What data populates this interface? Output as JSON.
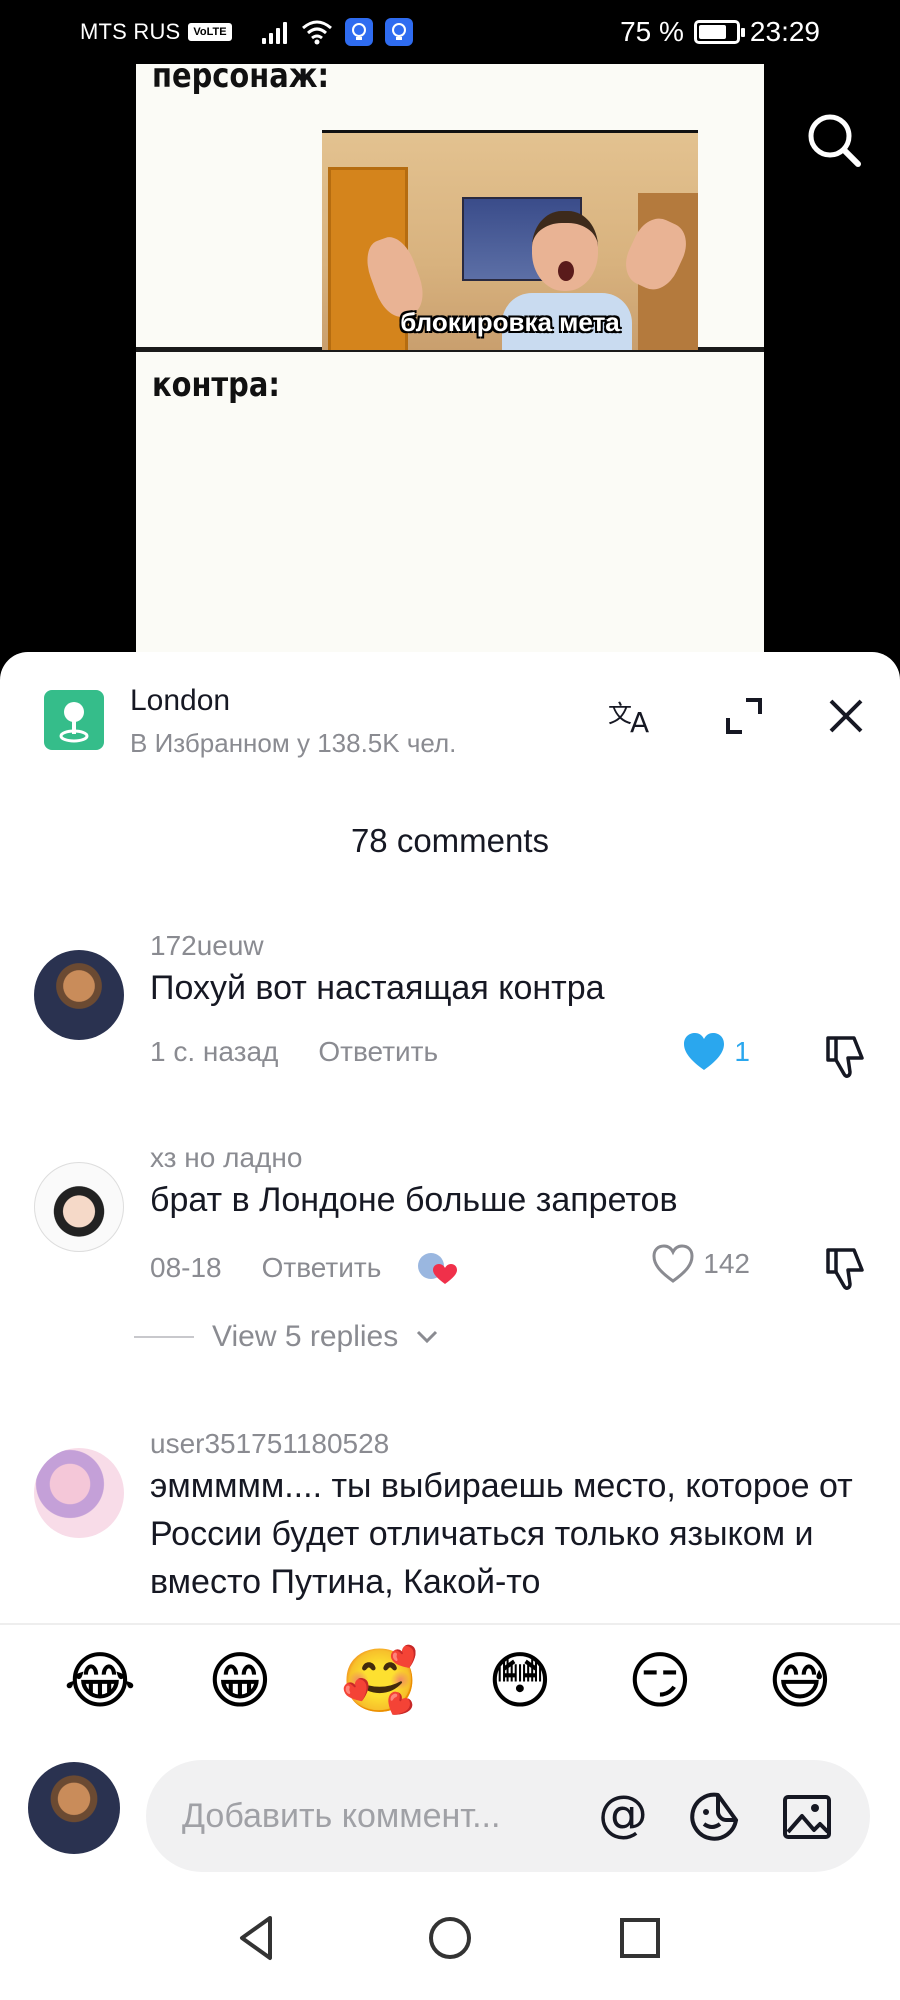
{
  "status_bar": {
    "carrier": "MTS RUS",
    "volte": "VoLTE",
    "battery": "75 %",
    "battery_level": 0.75,
    "time": "23:29"
  },
  "video": {
    "top_text": "персонаж:",
    "caption": "блокировка мета",
    "bottom_text": "контра:"
  },
  "sheet": {
    "place_title": "London",
    "place_subtitle": "В Избранном у 138.5K чел.",
    "comments_count": "78 comments"
  },
  "comments": [
    {
      "user": "172ueuw",
      "text": "Похуй вот настаящая контра",
      "time": "1 с. назад",
      "reply": "Ответить",
      "likes": "1",
      "liked": true
    },
    {
      "user": "хз но ладно",
      "text": "брат в Лондоне больше запретов",
      "time": "08-18",
      "reply": "Ответить",
      "likes": "142",
      "liked": false,
      "view_replies": "View 5 replies"
    },
    {
      "user": "user351751180528",
      "text": "эммммм.... ты выбираешь место, которое от России будет отличаться только языком и вместо Путина, Какой-то"
    }
  ],
  "emojis": [
    "😂",
    "😁",
    "🥰",
    "😳",
    "😏",
    "😅"
  ],
  "composer": {
    "placeholder": "Добавить коммент..."
  },
  "colors": {
    "liked_heart": "#2aa7ee",
    "place_icon": "#35bd8a",
    "alarm_icon": "#2f6cf0"
  }
}
